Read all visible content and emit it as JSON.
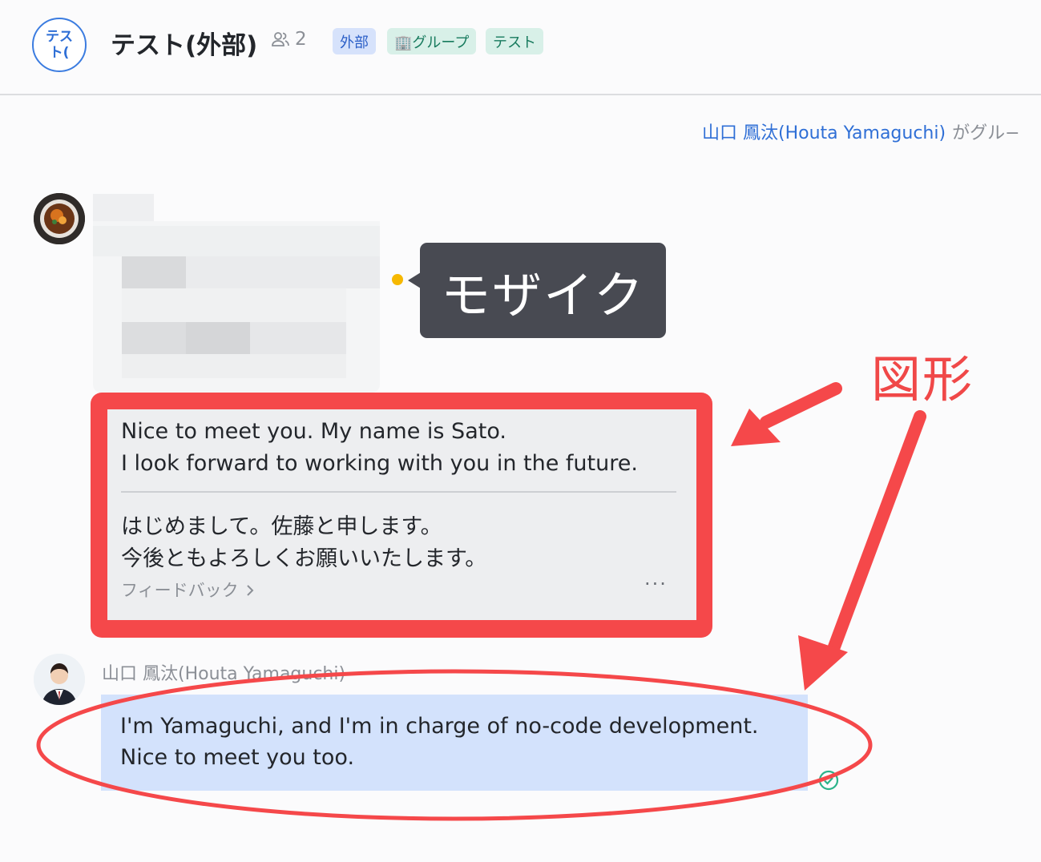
{
  "header": {
    "group_avatar_text": "テス\nト(",
    "title": "テスト(外部)",
    "member_count": "2",
    "tags": [
      "外部",
      "🏢グループ",
      "テスト"
    ]
  },
  "notice": {
    "who": "山口 鳳汰(Houta Yamaguchi)",
    "rest": "がグル−"
  },
  "annotations": {
    "mosaic_label": "モザイク",
    "shape_label": "図形",
    "accent_color": "#f04848",
    "callout_color": "#484a52"
  },
  "message1": {
    "line1": "Nice to meet you. My name is Sato.",
    "line2": "I look forward to working with you in the future.",
    "line3": "はじめまして。佐藤と申します。",
    "line4": "今後ともよろしくお願いいたします。",
    "feedback": "フィードバック",
    "more": "···"
  },
  "message2": {
    "sender": "山口 鳳汰(Houta Yamaguchi)",
    "line1": "I'm Yamaguchi, and I'm in charge of no-code development.",
    "line2": "Nice to meet you too."
  },
  "colors": {
    "link": "#2f6fd6",
    "outgoing_bubble": "#d3e2fc",
    "incoming_bubble": "#edeef0"
  }
}
